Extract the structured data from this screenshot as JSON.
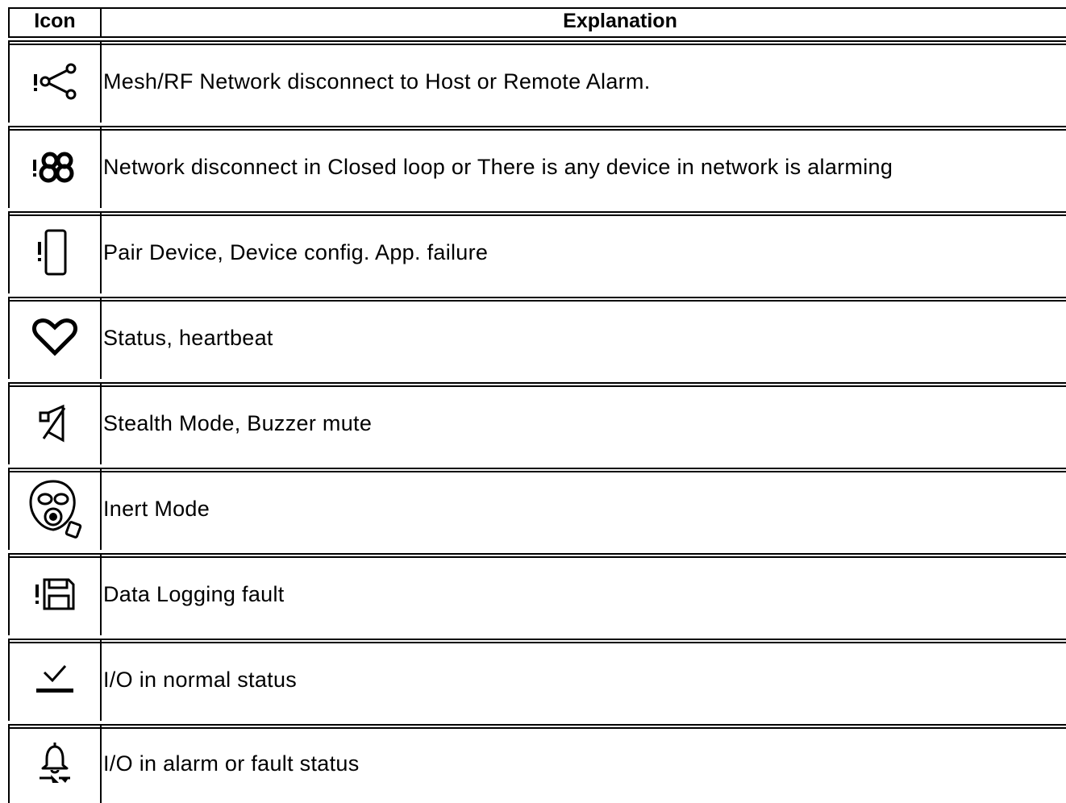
{
  "table": {
    "headers": {
      "icon": "Icon",
      "explanation": "Explanation"
    },
    "rows": [
      {
        "icon": "network-disconnect-icon",
        "explanation": "Mesh/RF Network disconnect to Host or Remote Alarm."
      },
      {
        "icon": "closed-loop-disconnect-icon",
        "explanation": "Network disconnect in Closed loop or There is any device in network is alarming"
      },
      {
        "icon": "pair-device-failure-icon",
        "explanation": "Pair Device, Device config. App. failure"
      },
      {
        "icon": "heartbeat-icon",
        "explanation": "Status, heartbeat"
      },
      {
        "icon": "buzzer-mute-icon",
        "explanation": "Stealth Mode, Buzzer mute"
      },
      {
        "icon": "gas-mask-icon",
        "explanation": "Inert Mode"
      },
      {
        "icon": "data-logging-fault-icon",
        "explanation": "Data Logging fault"
      },
      {
        "icon": "io-normal-icon",
        "explanation": "I/O in normal status"
      },
      {
        "icon": "io-alarm-icon",
        "explanation": "I/O in alarm or fault status"
      }
    ]
  }
}
